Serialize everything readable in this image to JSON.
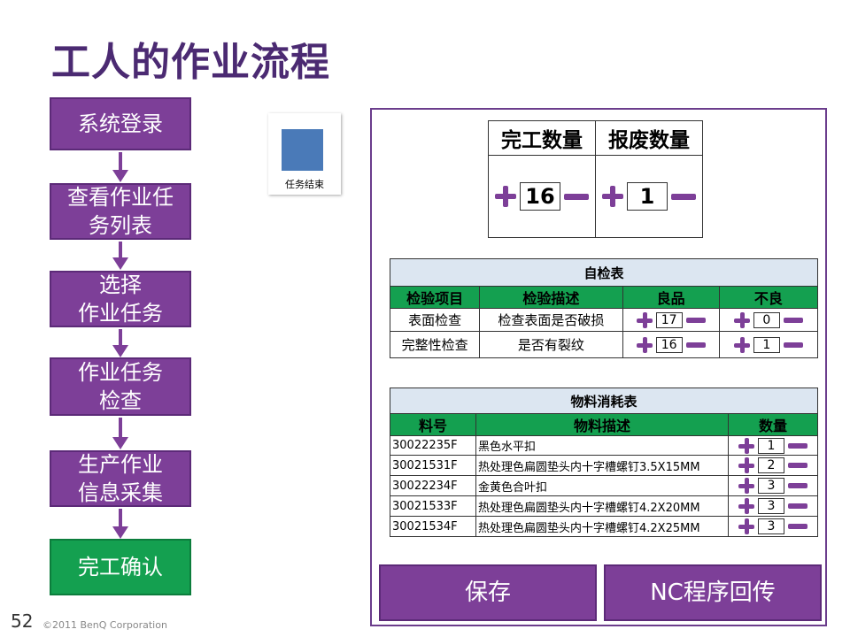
{
  "title": "工人的作业流程",
  "flow": {
    "steps": [
      "系统登录",
      "查看作业任\n务列表",
      "选择\n作业任务",
      "作业任务\n检查",
      "生产作业\n信息采集",
      "完工确认"
    ]
  },
  "card": {
    "label": "任务结束"
  },
  "qty": {
    "done_header": "完工数量",
    "scrap_header": "报废数量",
    "done_value": "16",
    "scrap_value": "1"
  },
  "check": {
    "caption": "自检表",
    "headers": [
      "检验项目",
      "检验描述",
      "良品",
      "不良"
    ],
    "rows": [
      {
        "item": "表面检查",
        "desc": "检查表面是否破损",
        "good": "17",
        "bad": "0"
      },
      {
        "item": "完整性检查",
        "desc": "是否有裂纹",
        "good": "16",
        "bad": "1"
      }
    ]
  },
  "materials": {
    "caption": "物料消耗表",
    "headers": [
      "料号",
      "物料描述",
      "数量"
    ],
    "rows": [
      {
        "code": "30022235F",
        "desc": "黑色水平扣",
        "qty": "1"
      },
      {
        "code": "30021531F",
        "desc": "热处理色扁圆垫头内十字槽螺钉3.5X15MM",
        "qty": "2"
      },
      {
        "code": "30022234F",
        "desc": "金黄色合叶扣",
        "qty": "3"
      },
      {
        "code": "30021533F",
        "desc": "热处理色扁圆垫头内十字槽螺钉4.2X20MM",
        "qty": "3"
      },
      {
        "code": "30021534F",
        "desc": "热处理色扁圆垫头内十字槽螺钉4.2X25MM",
        "qty": "3"
      }
    ]
  },
  "buttons": {
    "save": "保存",
    "nc_return": "NC程序回传"
  },
  "footer": {
    "page": "52",
    "copyright": "©2011 BenQ Corporation"
  },
  "colors": {
    "accent": "#7d3f98",
    "title": "#4b2a72",
    "green": "#14a050",
    "caption_bg": "#dce6f1",
    "icon": "#4a7ab8"
  }
}
